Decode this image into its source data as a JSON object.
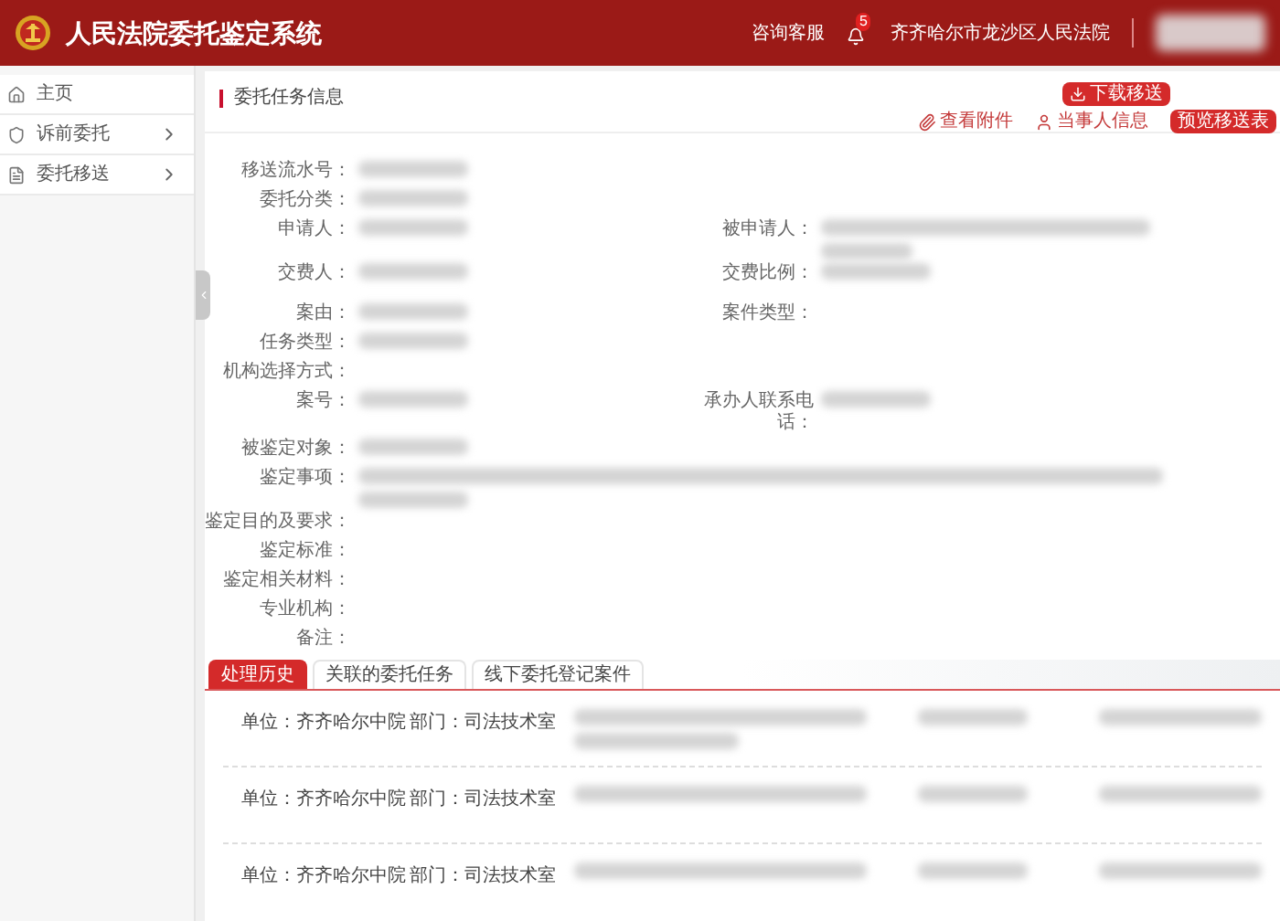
{
  "header": {
    "title": "人民法院委托鉴定系统",
    "links": [
      "咨询客服"
    ],
    "notifications": "5",
    "court": "齐齐哈尔市龙沙区人民法院"
  },
  "sidebar": {
    "items": [
      {
        "label": "主页",
        "expandable": false
      },
      {
        "label": "诉前委托",
        "expandable": true
      },
      {
        "label": "委托移送",
        "expandable": true
      }
    ]
  },
  "panel": {
    "title": "委托任务信息",
    "download": "下载移送",
    "links": [
      {
        "label": "查看附件"
      },
      {
        "label": "当事人信息"
      }
    ],
    "preview": "预览移送表"
  },
  "fields": [
    {
      "label": "移送流水号：",
      "redacted": true
    },
    {
      "label": "委托分类：",
      "redacted": true
    },
    {
      "label": "申请人：",
      "redacted": true,
      "right": {
        "label": "被申请人：",
        "redacted": true
      }
    },
    {
      "label": "交费人：",
      "redacted": true,
      "right": {
        "label": "交费比例：",
        "redacted": true
      }
    },
    {
      "label": "案由：",
      "redacted": true,
      "right": {
        "label": "案件类型：",
        "redacted": false
      }
    },
    {
      "label": "任务类型：",
      "redacted": true
    },
    {
      "label": "机构选择方式：",
      "redacted": false
    },
    {
      "label": "案号：",
      "redacted": true,
      "right": {
        "label": "承办人联系电话：",
        "redacted": true
      }
    },
    {
      "label": "被鉴定对象：",
      "redacted": true
    },
    {
      "label": "鉴定事项：",
      "redacted": true,
      "wide": true
    },
    {
      "label": "鉴定目的及要求：",
      "redacted": false
    },
    {
      "label": "鉴定标准：",
      "redacted": false
    },
    {
      "label": "鉴定相关材料：",
      "redacted": false
    },
    {
      "label": "专业机构：",
      "redacted": false
    },
    {
      "label": "备注：",
      "redacted": false
    }
  ],
  "tabs": [
    {
      "label": "处理历史",
      "selected": true
    },
    {
      "label": "关联的委托任务",
      "selected": false
    },
    {
      "label": "线下委托登记案件",
      "selected": false
    }
  ],
  "history": [
    {
      "unit": "单位：齐齐哈尔中院",
      "dept": "部门：司法技术室"
    },
    {
      "unit": "单位：齐齐哈尔中院",
      "dept": "部门：司法技术室"
    },
    {
      "unit": "单位：齐齐哈尔中院",
      "dept": "部门：司法技术室"
    }
  ]
}
